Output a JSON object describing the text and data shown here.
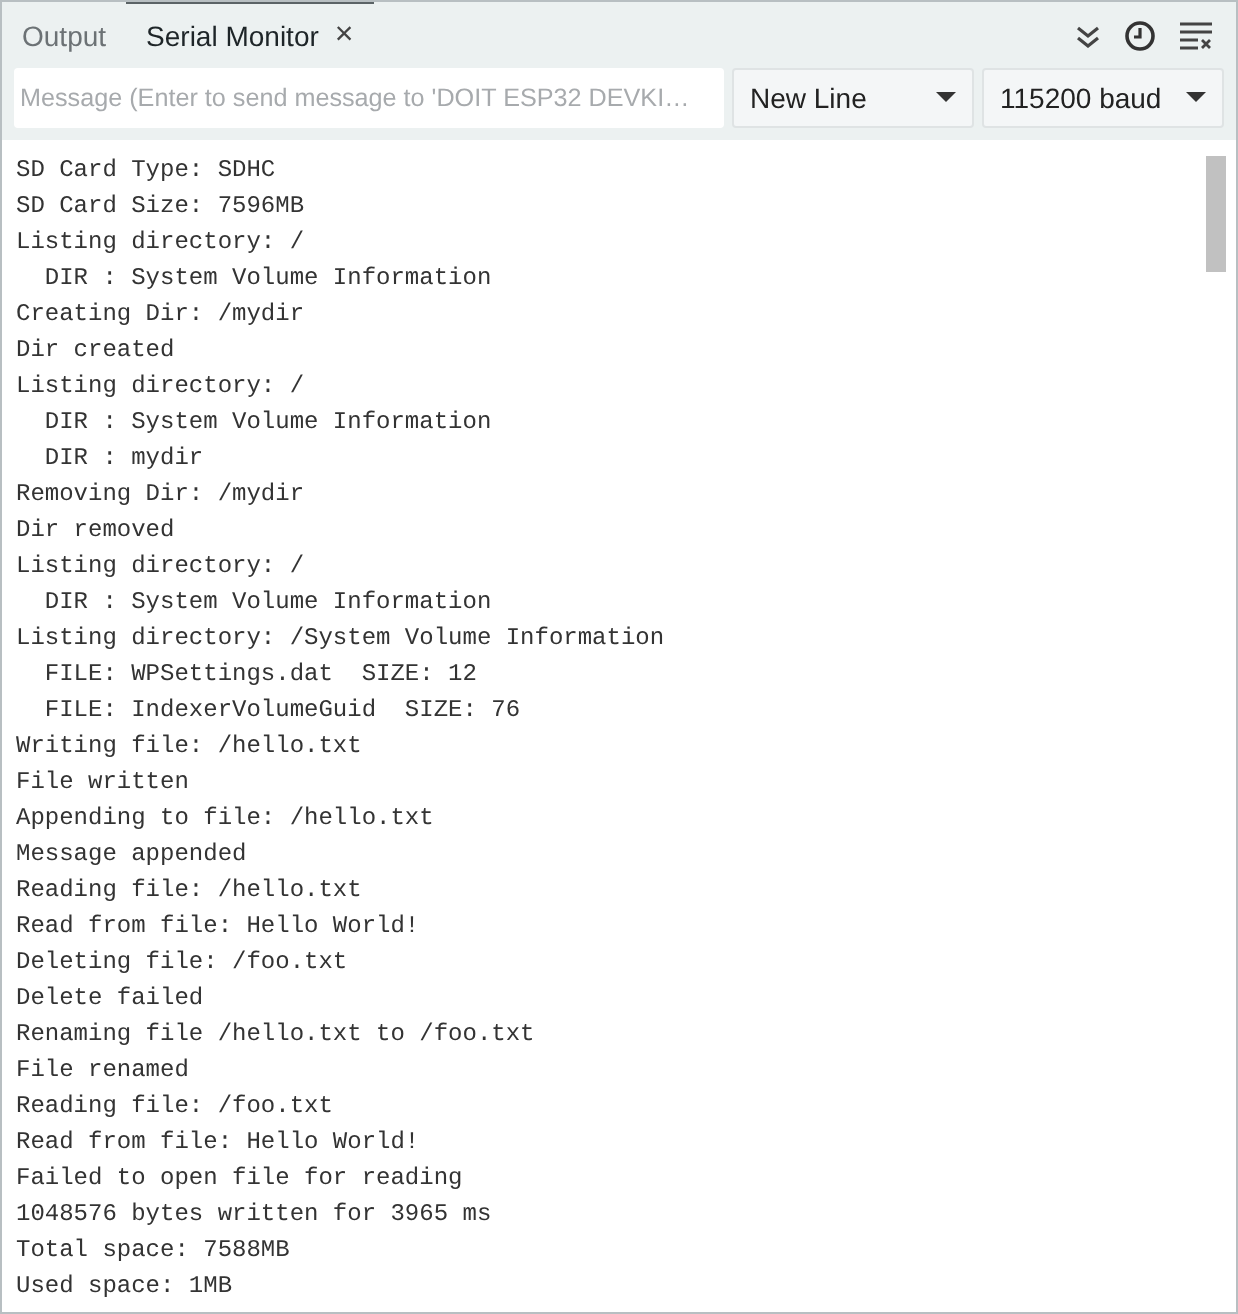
{
  "tabs": [
    {
      "label": "Output",
      "selected": false
    },
    {
      "label": "Serial Monitor",
      "selected": true,
      "close": "×"
    }
  ],
  "message_field": {
    "placeholder": "Message (Enter to send message to 'DOIT ESP32 DEVKI…"
  },
  "line_ending": {
    "value": "New Line"
  },
  "baud_rate": {
    "value": "115200 baud"
  },
  "output_lines": [
    "SD Card Type: SDHC",
    "SD Card Size: 7596MB",
    "Listing directory: /",
    "  DIR : System Volume Information",
    "Creating Dir: /mydir",
    "Dir created",
    "Listing directory: /",
    "  DIR : System Volume Information",
    "  DIR : mydir",
    "Removing Dir: /mydir",
    "Dir removed",
    "Listing directory: /",
    "  DIR : System Volume Information",
    "Listing directory: /System Volume Information",
    "  FILE: WPSettings.dat  SIZE: 12",
    "  FILE: IndexerVolumeGuid  SIZE: 76",
    "Writing file: /hello.txt",
    "File written",
    "Appending to file: /hello.txt",
    "Message appended",
    "Reading file: /hello.txt",
    "Read from file: Hello World!",
    "Deleting file: /foo.txt",
    "Delete failed",
    "Renaming file /hello.txt to /foo.txt",
    "File renamed",
    "Reading file: /foo.txt",
    "Read from file: Hello World!",
    "Failed to open file for reading",
    "1048576 bytes written for 3965 ms",
    "Total space: 7588MB",
    "Used space: 1MB"
  ]
}
